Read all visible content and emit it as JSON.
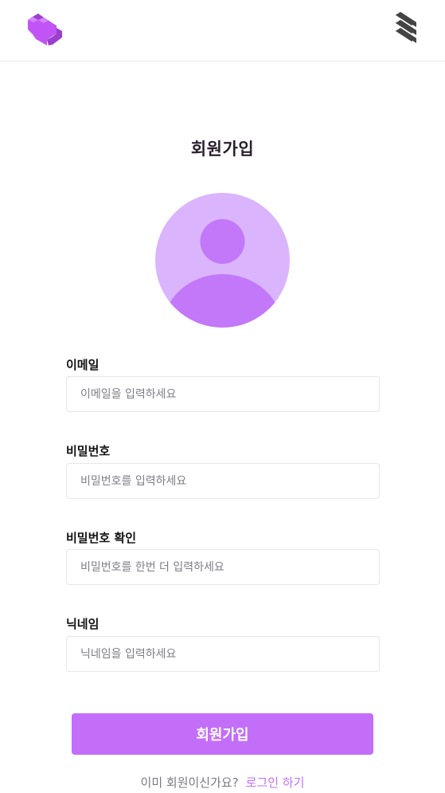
{
  "header": {
    "logo_icon": "pixel-heart-icon",
    "menu_icon": "stacked-bars-menu-icon"
  },
  "page": {
    "title": "회원가입"
  },
  "avatar": {
    "icon": "user-avatar-icon",
    "bg_color": "#dab4fd",
    "fg_color": "#c278f9"
  },
  "form": {
    "email": {
      "label": "이메일",
      "placeholder": "이메일을 입력하세요",
      "value": ""
    },
    "password": {
      "label": "비밀번호",
      "placeholder": "비밀번호를 입력하세요",
      "value": ""
    },
    "password_confirm": {
      "label": "비밀번호 확인",
      "placeholder": "비밀번호를 한번 더 입력하세요",
      "value": ""
    },
    "nickname": {
      "label": "닉네임",
      "placeholder": "닉네임을 입력하세요",
      "value": ""
    },
    "submit_label": "회원가입"
  },
  "footer": {
    "prompt": "이미 회원이신가요?",
    "login_link": "로그인 하기"
  },
  "colors": {
    "accent": "#c36ef9",
    "logo_front": "#c154f5",
    "logo_side": "#9a3fd0",
    "menu": "#444444"
  }
}
